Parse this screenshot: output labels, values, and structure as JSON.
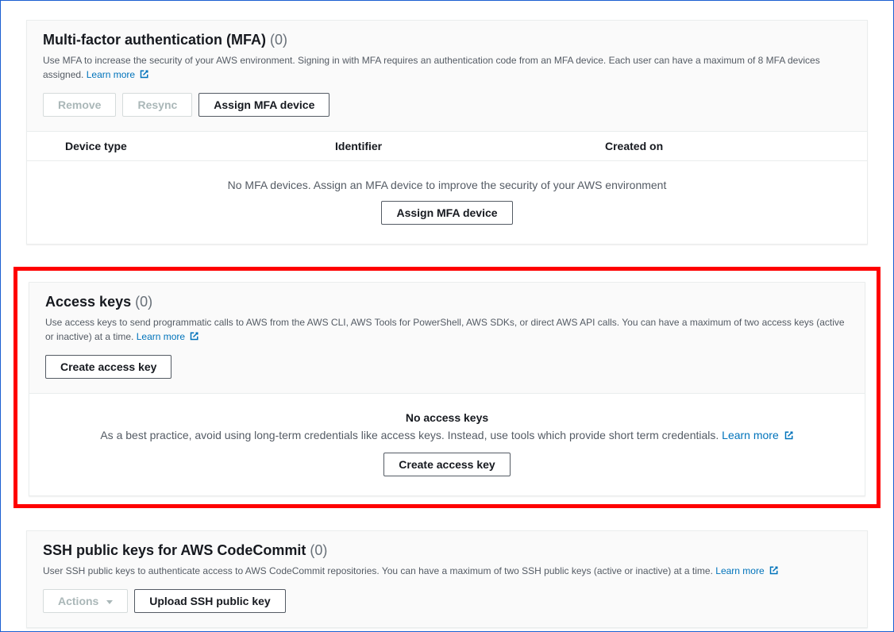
{
  "mfa": {
    "title": "Multi-factor authentication (MFA)",
    "count": "(0)",
    "desc": "Use MFA to increase the security of your AWS environment. Signing in with MFA requires an authentication code from an MFA device. Each user can have a maximum of 8 MFA devices assigned.",
    "learn_more": "Learn more",
    "buttons": {
      "remove": "Remove",
      "resync": "Resync",
      "assign": "Assign MFA device"
    },
    "columns": {
      "device_type": "Device type",
      "identifier": "Identifier",
      "created_on": "Created on"
    },
    "empty_msg": "No MFA devices. Assign an MFA device to improve the security of your AWS environment",
    "empty_btn": "Assign MFA device"
  },
  "access_keys": {
    "title": "Access keys",
    "count": "(0)",
    "desc": "Use access keys to send programmatic calls to AWS from the AWS CLI, AWS Tools for PowerShell, AWS SDKs, or direct AWS API calls. You can have a maximum of two access keys (active or inactive) at a time.",
    "learn_more": "Learn more",
    "buttons": {
      "create": "Create access key"
    },
    "empty_title": "No access keys",
    "empty_subtitle": "As a best practice, avoid using long-term credentials like access keys. Instead, use tools which provide short term credentials.",
    "empty_learn_more": "Learn more",
    "empty_btn": "Create access key"
  },
  "ssh": {
    "title": "SSH public keys for AWS CodeCommit",
    "count": "(0)",
    "desc": "User SSH public keys to authenticate access to AWS CodeCommit repositories. You can have a maximum of two SSH public keys (active or inactive) at a time.",
    "learn_more": "Learn more",
    "buttons": {
      "actions": "Actions",
      "upload": "Upload SSH public key"
    }
  }
}
